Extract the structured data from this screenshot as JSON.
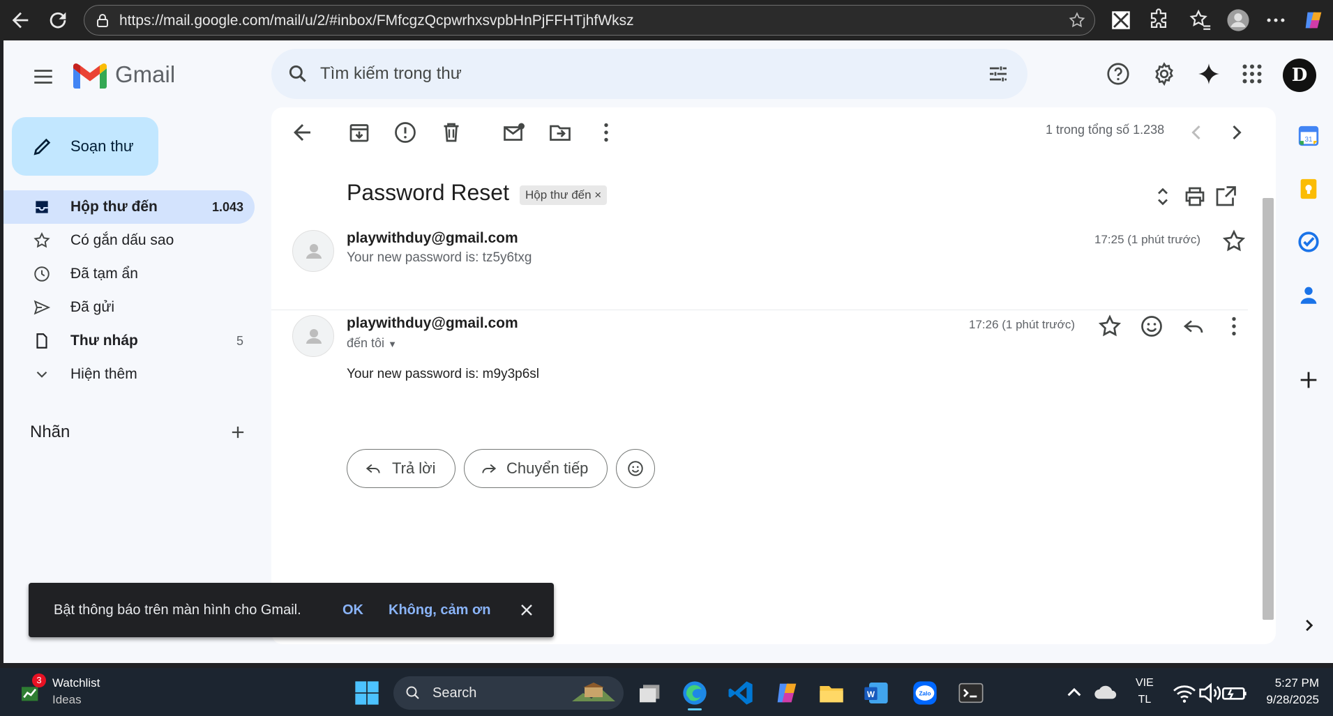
{
  "browser": {
    "url": "https://mail.google.com/mail/u/2/#inbox/FMfcgzQcpwrhxsvpbHnPjFFHTjhfWksz"
  },
  "app": {
    "logo_text": "Gmail",
    "search_placeholder": "Tìm kiếm trong thư",
    "avatar_letter": "D"
  },
  "sidebar": {
    "compose_label": "Soạn thư",
    "items": [
      {
        "label": "Hộp thư đến",
        "count": "1.043"
      },
      {
        "label": "Có gắn dấu sao",
        "count": ""
      },
      {
        "label": "Đã tạm ẩn",
        "count": ""
      },
      {
        "label": "Đã gửi",
        "count": ""
      },
      {
        "label": "Thư nháp",
        "count": "5"
      },
      {
        "label": "Hiện thêm",
        "count": ""
      }
    ],
    "labels_title": "Nhãn"
  },
  "toolbar": {
    "pager": "1 trong tổng số 1.238"
  },
  "thread": {
    "subject": "Password Reset",
    "label_chip": "Hộp thư đến",
    "messages": [
      {
        "sender": "playwithduy@gmail.com",
        "snippet": "Your new password is: tz5y6txg",
        "time": "17:25 (1 phút trước)"
      },
      {
        "sender": "playwithduy@gmail.com",
        "to": "đến tôi",
        "body": "Your new password is: m9y3p6sl",
        "time": "17:26 (1 phút trước)"
      }
    ],
    "reply_label": "Trả lời",
    "forward_label": "Chuyển tiếp"
  },
  "snackbar": {
    "text": "Bật thông báo trên màn hình cho Gmail.",
    "ok": "OK",
    "no": "Không, cảm ơn"
  },
  "taskbar": {
    "widget_title": "Watchlist",
    "widget_sub": "Ideas",
    "widget_badge": "3",
    "search_label": "Search",
    "lang_line1": "VIE",
    "lang_line2": "TL",
    "time": "5:27 PM",
    "date": "9/28/2025"
  },
  "colors": {
    "accent": "#c2e7ff",
    "active_nav": "#d3e3fd",
    "link": "#8ab4f8"
  }
}
